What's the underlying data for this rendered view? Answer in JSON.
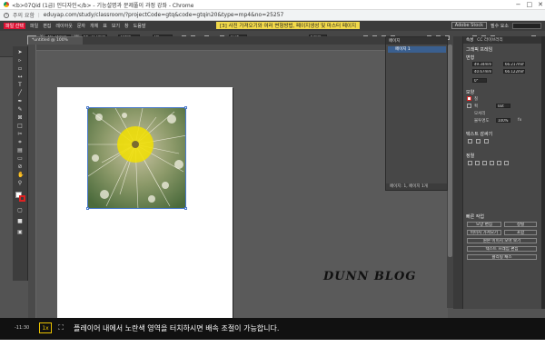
{
  "browser": {
    "title": "<b>07Qid (1급) 인디자인</b> - 기능설명과 문제풀이 과정 강좌 - Chrome",
    "warning": "주의 요함",
    "url": "eduyap.com/study/classroom/?projectCode=gtq&code=gtqin20&type=mp4&no=25257",
    "minimize": "−",
    "maximize": "□",
    "close": "✕"
  },
  "app": {
    "menus": [
      "파일",
      "편집",
      "레이아웃",
      "문자",
      "개체",
      "표",
      "보기",
      "창",
      "도움말"
    ],
    "logo_label": "파일 선택",
    "banner": "[3] 사진 가져오기와 여러 변형방법, 페이지생성 및 마스터 페이지",
    "adobe_stock": "Adobe Stock",
    "essentials": "필수 요소",
    "doc_tab": "*untitled @ 100%",
    "control": {
      "x": "49.34mm",
      "y": "40.67mm",
      "w": "66.217mm",
      "h": "66.122mm",
      "scale_x": "100%",
      "scale_y": "100%",
      "angle": "0°",
      "shear": "0°",
      "stroke": "0 pt",
      "dims": "5mm",
      "opacity": "100%"
    }
  },
  "pages_panel": {
    "title": "페이지",
    "row": "페이지 1",
    "footer": "페이지: 1, 페이지 1개"
  },
  "properties": {
    "tabs": [
      "속성",
      "CC 라이브러리"
    ],
    "heading": "그래픽 프레임",
    "transform": "변형",
    "x": "49.34mm",
    "y": "40.67mm",
    "w": "66.217mm",
    "h": "66.122mm",
    "angle": "0°",
    "appearance": "모양",
    "fill": "칠",
    "stroke": "획",
    "corner": "모서리",
    "opacity": "불투명도",
    "opacity_val": "100%",
    "stroke_val": "0pt",
    "fx": "fx",
    "wrap": "텍스트 감싸기",
    "align": "정렬",
    "quick": "빠른 작업",
    "text_frame_options": "텍스트 프레임",
    "frame_fit": "프레임 맞춤",
    "auto_fit": "자동 맞춤",
    "buttons": [
      "모양 편집",
      "정렬",
      "이미지 가져오기",
      "포함",
      "원본 이미지 모아 보기",
      "텍스트 프레임 편집",
      "클리핑 패스",
      "",
      "렌더링 사용"
    ]
  },
  "player": {
    "time": "-11:30",
    "speed": "1x",
    "caption": "플레이어 내에서 노란색 영역을 터치하시면 배속 조절이 가능합니다."
  },
  "watermark": "DUNN BLOG"
}
